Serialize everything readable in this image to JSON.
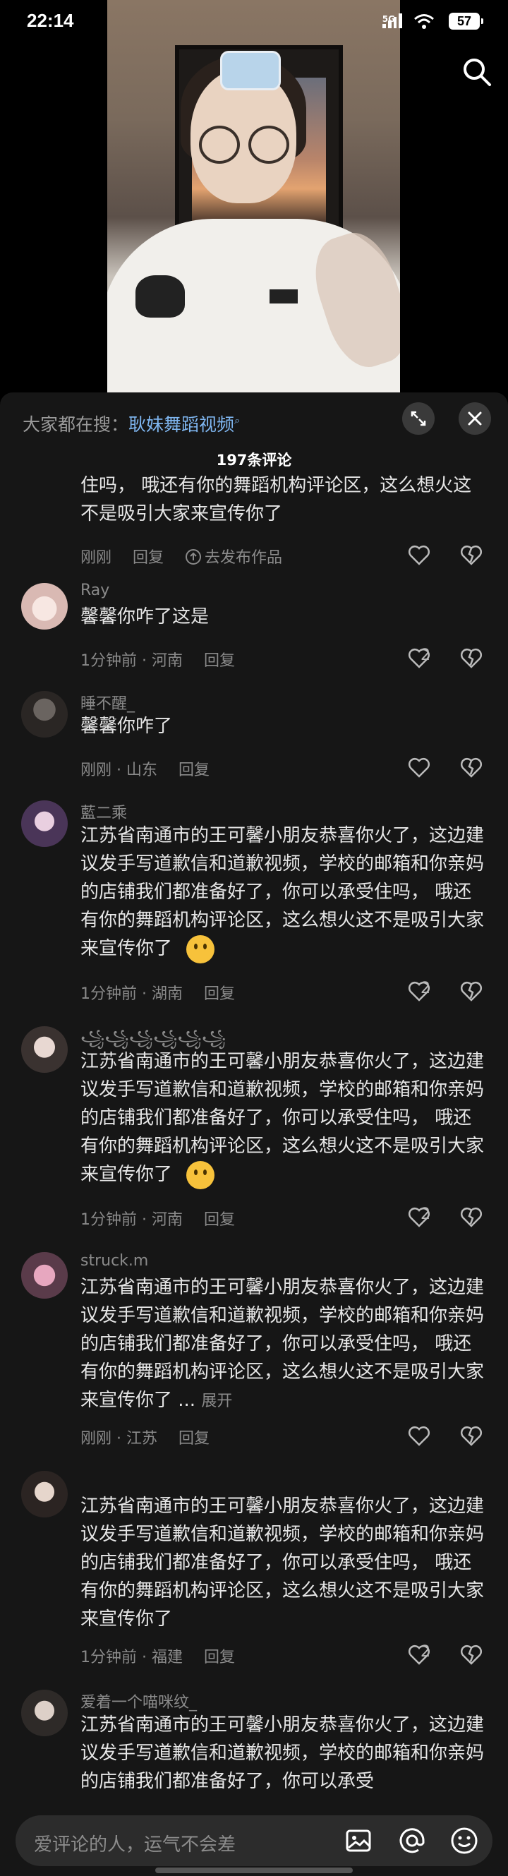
{
  "status": {
    "time": "22:14",
    "network": "5G",
    "battery": "57"
  },
  "panel": {
    "hot_label": "大家都在搜：",
    "hot_term": "耿妹舞蹈视频",
    "comment_count": "197条评论"
  },
  "comments": [
    {
      "username": "",
      "text": "住吗， 哦还有你的舞蹈机构评论区，这么想火这不是吸引大家来宣传你了",
      "time": "刚刚",
      "location": "",
      "reply": "回复",
      "extra": "去发布作品",
      "likes": ""
    },
    {
      "username": "Ray",
      "text": "馨馨你咋了这是",
      "time": "1分钟前",
      "location": "河南",
      "reply": "回复",
      "likes": "2"
    },
    {
      "username": "睡不醒_",
      "text": "馨馨你咋了",
      "time": "刚刚",
      "location": "山东",
      "reply": "回复",
      "likes": ""
    },
    {
      "username": "藍二乘",
      "text": "江苏省南通市的王可馨小朋友恭喜你火了，这边建议发手写道歉信和道歉视频，学校的邮箱和你亲妈的店铺我们都准备好了，你可以承受住吗， 哦还有你的舞蹈机构评论区，这么想火这不是吸引大家来宣传你了",
      "time": "1分钟前",
      "location": "湖南",
      "reply": "回复",
      "likes": "2"
    },
    {
      "username": "꧁꧁꧁꧁꧁꧁",
      "text": "江苏省南通市的王可馨小朋友恭喜你火了，这边建议发手写道歉信和道歉视频，学校的邮箱和你亲妈的店铺我们都准备好了，你可以承受住吗， 哦还有你的舞蹈机构评论区，这么想火这不是吸引大家来宣传你了",
      "time": "1分钟前",
      "location": "河南",
      "reply": "回复",
      "likes": "2"
    },
    {
      "username": "struck.m",
      "text": "江苏省南通市的王可馨小朋友恭喜你火了，这边建议发手写道歉信和道歉视频，学校的邮箱和你亲妈的店铺我们都准备好了，你可以承受住吗， 哦还有你的舞蹈机构评论区，这么想火这不是吸引大家来宣传你了 ...",
      "more": "展开",
      "time": "刚刚",
      "location": "江苏",
      "reply": "回复",
      "likes": ""
    },
    {
      "username": "",
      "text": "江苏省南通市的王可馨小朋友恭喜你火了，这边建议发手写道歉信和道歉视频，学校的邮箱和你亲妈的店铺我们都准备好了，你可以承受住吗， 哦还有你的舞蹈机构评论区，这么想火这不是吸引大家来宣传你了",
      "time": "1分钟前",
      "location": "福建",
      "reply": "回复",
      "likes": "2"
    },
    {
      "username": "爱着一个喵咪纹_",
      "text": "江苏省南通市的王可馨小朋友恭喜你火了，这边建议发手写道歉信和道歉视频，学校的邮箱和你亲妈的店铺我们都准备好了，你可以承受",
      "time": "",
      "location": "",
      "reply": "",
      "likes": ""
    }
  ],
  "input": {
    "placeholder": "爱评论的人，运气不会差"
  },
  "icons": {
    "search": "search-icon",
    "expand": "expand-icon",
    "close": "close-icon",
    "like": "heart-icon",
    "dislike": "broken-heart-icon",
    "image": "image-icon",
    "mention": "at-icon",
    "emoji": "emoji-icon",
    "publish": "upload-icon"
  }
}
